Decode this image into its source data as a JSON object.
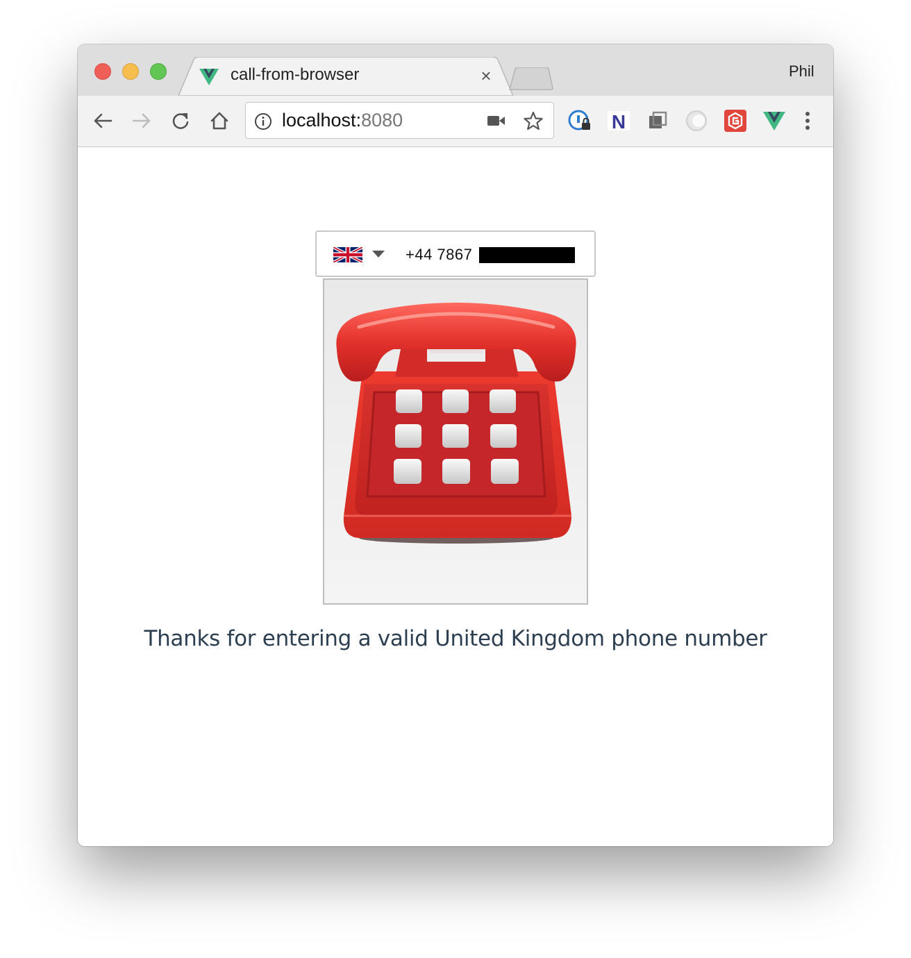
{
  "browser": {
    "tab_title": "call-from-browser",
    "tab_close": "×",
    "profile_name": "Phil",
    "url_host": "localhost:",
    "url_port": "8080"
  },
  "extensions": [
    "password-manager-icon",
    "n-extension-icon",
    "copy-extension-icon",
    "circle-extension-icon",
    "red-extension-icon",
    "vue-devtools-icon"
  ],
  "phone_form": {
    "country": "United Kingdom",
    "country_flag": "gb-flag-icon",
    "number_prefix": "+44 7867"
  },
  "message": "Thanks for entering a valid United Kingdom phone number",
  "colors": {
    "titlebar": "#dedede",
    "toolbar": "#f2f2f2",
    "message_text": "#2c3e50",
    "phone_red": "#d42a2a",
    "vue_green": "#41b883"
  }
}
